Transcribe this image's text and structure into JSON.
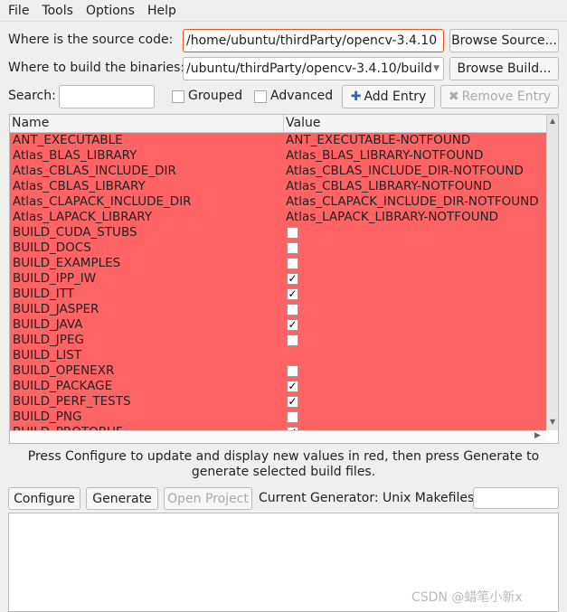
{
  "menu": [
    "File",
    "Tools",
    "Options",
    "Help"
  ],
  "source": {
    "label": "Where is the source code:",
    "value": "/home/ubuntu/thirdParty/opencv-3.4.10",
    "browse": "Browse Source..."
  },
  "build": {
    "label": "Where to build the binaries:",
    "value": "/ubuntu/thirdParty/opencv-3.4.10/build",
    "browse": "Browse Build..."
  },
  "search": {
    "label": "Search:",
    "value": ""
  },
  "grouped": {
    "label": "Grouped",
    "checked": false
  },
  "advanced": {
    "label": "Advanced",
    "checked": false
  },
  "add_entry": "Add Entry",
  "remove_entry": "Remove Entry",
  "table": {
    "headers": [
      "Name",
      "Value"
    ],
    "row_color": "#ff6464",
    "rows": [
      {
        "name": "ANT_EXECUTABLE",
        "value": "ANT_EXECUTABLE-NOTFOUND"
      },
      {
        "name": "Atlas_BLAS_LIBRARY",
        "value": "Atlas_BLAS_LIBRARY-NOTFOUND"
      },
      {
        "name": "Atlas_CBLAS_INCLUDE_DIR",
        "value": "Atlas_CBLAS_INCLUDE_DIR-NOTFOUND"
      },
      {
        "name": "Atlas_CBLAS_LIBRARY",
        "value": "Atlas_CBLAS_LIBRARY-NOTFOUND"
      },
      {
        "name": "Atlas_CLAPACK_INCLUDE_DIR",
        "value": "Atlas_CLAPACK_INCLUDE_DIR-NOTFOUND"
      },
      {
        "name": "Atlas_LAPACK_LIBRARY",
        "value": "Atlas_LAPACK_LIBRARY-NOTFOUND"
      },
      {
        "name": "BUILD_CUDA_STUBS",
        "checked": false
      },
      {
        "name": "BUILD_DOCS",
        "checked": false
      },
      {
        "name": "BUILD_EXAMPLES",
        "checked": false
      },
      {
        "name": "BUILD_IPP_IW",
        "checked": true
      },
      {
        "name": "BUILD_ITT",
        "checked": true
      },
      {
        "name": "BUILD_JASPER",
        "checked": false
      },
      {
        "name": "BUILD_JAVA",
        "checked": true
      },
      {
        "name": "BUILD_JPEG",
        "checked": false
      },
      {
        "name": "BUILD_LIST",
        "value": ""
      },
      {
        "name": "BUILD_OPENEXR",
        "checked": false
      },
      {
        "name": "BUILD_PACKAGE",
        "checked": true
      },
      {
        "name": "BUILD_PERF_TESTS",
        "checked": true
      },
      {
        "name": "BUILD_PNG",
        "checked": false
      },
      {
        "name": "BUILD_PROTOBUF",
        "checked": true
      }
    ]
  },
  "hint": "Press Configure to update and display new values in red, then press Generate to generate selected build files.",
  "configure": "Configure",
  "generate": "Generate",
  "open_project": "Open Project",
  "generator": "Current Generator: Unix Makefiles",
  "watermark": "CSDN @蜡笔小新x"
}
